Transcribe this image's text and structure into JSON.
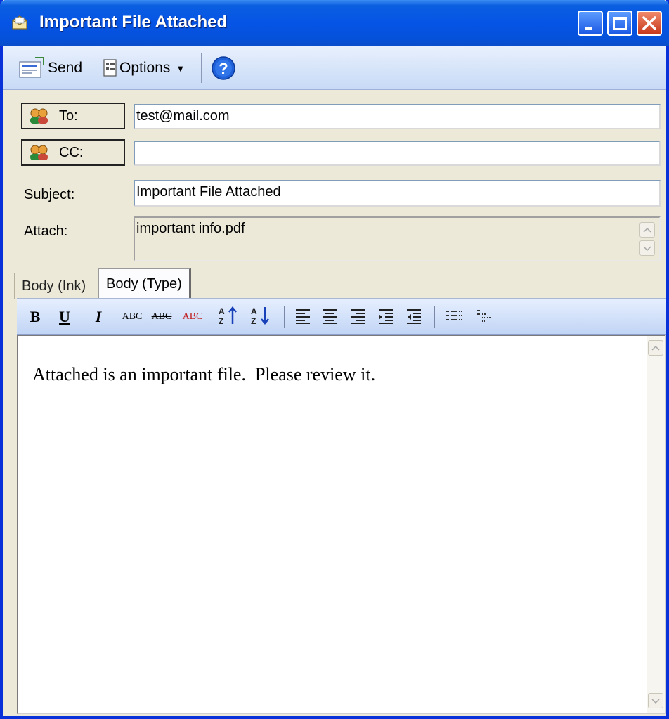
{
  "window": {
    "title": "Important File Attached"
  },
  "toolbar": {
    "send_label": "Send",
    "options_label": "Options"
  },
  "fields": {
    "to_label": "To:",
    "to_value": "test@mail.com",
    "cc_label": "CC:",
    "cc_value": "",
    "subject_label": "Subject:",
    "subject_value": "Important File Attached",
    "attach_label": "Attach:",
    "attach_value": "important info.pdf"
  },
  "tabs": [
    {
      "label": "Body (Ink)",
      "active": false
    },
    {
      "label": "Body (Type)",
      "active": true
    }
  ],
  "format_toolbar": {
    "bold": "B",
    "underline": "U",
    "italic": "I",
    "smallcaps": "ABC",
    "strikeout": "ABC",
    "color": "ABC"
  },
  "body": {
    "text": "Attached is an important file.  Please review it."
  },
  "colors": {
    "titlebar": "#0654e6",
    "frame": "#0831d9",
    "dialog_bg": "#ece9d8",
    "close_button": "#c6361a"
  }
}
